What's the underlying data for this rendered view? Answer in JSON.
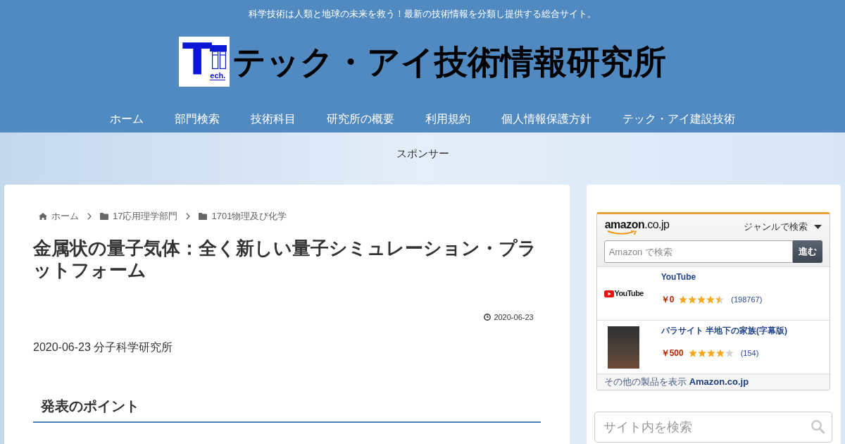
{
  "header": {
    "tagline": "科学技術は人類と地球の未来を救う！最新の技術情報を分類し提供する総合サイト。",
    "logo": {
      "letter": "T",
      "suffix": "ech."
    },
    "site_title": "テック・アイ技術情報研究所"
  },
  "nav": [
    {
      "label": "ホーム"
    },
    {
      "label": "部門検索"
    },
    {
      "label": "技術科目"
    },
    {
      "label": "研究所の概要"
    },
    {
      "label": "利用規約"
    },
    {
      "label": "個人情報保護方針"
    },
    {
      "label": "テック・アイ建設技術"
    }
  ],
  "sponsor": {
    "label": "スポンサー"
  },
  "article": {
    "breadcrumb": [
      {
        "kind": "home",
        "label": "ホーム"
      },
      {
        "kind": "category",
        "label": "17応用理学部門"
      },
      {
        "kind": "category",
        "label": "1701物理及び化学"
      }
    ],
    "title": "金属状の量子気体：全く新しい量子シミュレーション・プラットフォーム",
    "date": "2020-06-23",
    "source_line": "2020-06-23 分子科学研究所",
    "section_heading": "発表のポイント"
  },
  "amazon_widget": {
    "logo": "**amazon**.co.jp",
    "genre_dropdown": "ジャンルで検索",
    "search": {
      "placeholder": "Amazon で検索"
    },
    "search_button": "進む",
    "products": [
      {
        "image": {
          "kind": "logo",
          "text": "YouTube"
        },
        "title": "YouTube",
        "price": "￥0",
        "stars": 4.5,
        "reviews": "(198767)"
      },
      {
        "image": {
          "kind": "photo"
        },
        "title": "パラサイト 半地下の家族(字幕版)",
        "price": "￥500",
        "stars": 4,
        "reviews": "(154)"
      }
    ],
    "footer": {
      "text": "その他の製品を表示",
      "link": "Amazon.co.jp"
    }
  },
  "site_search": {
    "placeholder": "サイト内を検索"
  }
}
